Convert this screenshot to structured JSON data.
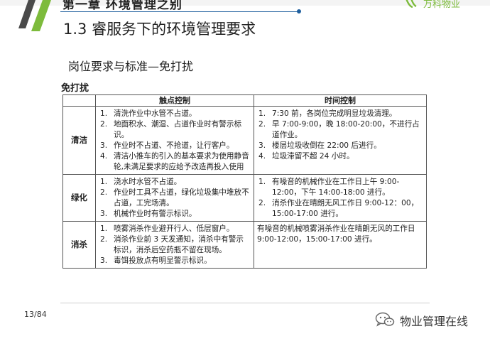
{
  "header": {
    "chapter_cut_text": "第一章 环境管理之别",
    "logo_text": "万科物业",
    "section_title": "1.3 睿服务下的环境管理要求",
    "subtitle": "岗位要求与标准—免打扰"
  },
  "table": {
    "label": "免打扰",
    "columns": [
      "触点控制",
      "时间控制"
    ],
    "rows": [
      {
        "category": "清洁",
        "touch": [
          {
            "n": "1.",
            "text": "清洗作业中水管不占道。"
          },
          {
            "n": "2.",
            "text": "地面积水、潮湿、占道作业时有警示标识。"
          },
          {
            "n": "3.",
            "text": "作业时不占道、不抢道，让行客户。"
          },
          {
            "n": "4.",
            "text": "清洁小推车的引入的基本要求为使用静音轮,未满足要求的应给予改造再投入使用"
          }
        ],
        "time": [
          {
            "n": "1.",
            "text": "7:30 前，各岗位完成明显垃圾清理。"
          },
          {
            "n": "2.",
            "text": "早 7:00-9:00，晚 18:00-20:00，不进行占道作业。"
          },
          {
            "n": "3.",
            "text": "楼层垃圾收倒在 22:00 后进行。"
          },
          {
            "n": "4.",
            "text": "垃圾滞留不超 24 小时。"
          }
        ]
      },
      {
        "category": "绿化",
        "touch": [
          {
            "n": "1.",
            "text": "浇水时水管不占道。"
          },
          {
            "n": "2.",
            "text": "作业时工具不占道，绿化垃圾集中堆放不占道，工完场清。"
          },
          {
            "n": "3.",
            "text": "机械作业时有警示标识。"
          }
        ],
        "time": [
          {
            "n": "1.",
            "text": "有噪音的机械作业在工作日上午 9:00-12:00，下午 14:00-18:00 进行。"
          },
          {
            "n": "2.",
            "text": "消杀作业在晴朗无风工作日 9:00-12：00，15:00-17:00 进行。"
          }
        ]
      },
      {
        "category": "消杀",
        "touch": [
          {
            "n": "1.",
            "text": "喷雾消杀作业避开行人、低层窗户。"
          },
          {
            "n": "2.",
            "text": "消杀作业前 3 天发通知，消杀中有警示标识，消杀后空药瓶不留在现场。"
          },
          {
            "n": "3.",
            "text": "毒饵投放点有明显警示标识。"
          }
        ],
        "time_text": "有噪音的机械喷雾消杀作业在晴朗无风的工作日 9:00-12:00，15:00-17:00 进行。"
      }
    ]
  },
  "footer": {
    "page": "13/84",
    "watermark": "物业管理在线"
  },
  "colors": {
    "accent_green": "#7dbb3c",
    "rule_blue": "#1f5f9e",
    "slash_dark": "#4a4a4a"
  },
  "icons": [
    "slash-logo-icon",
    "vanke-logo-icon",
    "wechat-icon"
  ]
}
